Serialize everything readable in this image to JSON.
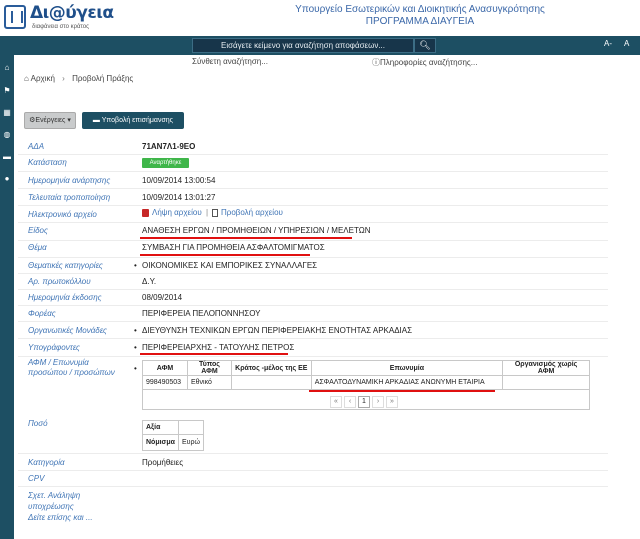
{
  "header": {
    "logo_title": "Δι@ύγεια",
    "logo_subtitle": "διαφάνεια στο κράτος",
    "ministry_line1": "Υπουργείο Εσωτερικών και Διοικητικής Ανασυγκρότησης",
    "ministry_line2": "ΠΡΟΓΡΑΜΜΑ ΔΙΑΥΓΕΙΑ"
  },
  "search": {
    "placeholder": "Εισάγετε κείμενο για αναζήτηση αποφάσεων...",
    "advanced": "Σύνθετη αναζήτηση...",
    "info": "Πληροφορίες αναζήτησης...",
    "font_decrease": "A-",
    "font_increase": "A"
  },
  "breadcrumb": {
    "home": "Αρχική",
    "current": "Προβολή Πράξης"
  },
  "actions": {
    "actions_label": "Ενέργειες",
    "report_label": "Υποβολή επισήμανσης"
  },
  "fields": {
    "ada_label": "ΑΔΑ",
    "ada": "71ΑΝ7Λ1-9ΕΟ",
    "status_label": "Κατάσταση",
    "status": "Αναρτήθηκε",
    "posted_label": "Ημερομηνία ανάρτησης",
    "posted": "10/09/2014 13:00:54",
    "modified_label": "Τελευταία τροποποίηση",
    "modified": "10/09/2014 13:01:27",
    "file_label": "Ηλεκτρονικό αρχείο",
    "download": "Λήψη αρχείου",
    "view": "Προβολή αρχείου",
    "type_label": "Είδος",
    "type": "ΑΝΑΘΕΣΗ ΕΡΓΩΝ / ΠΡΟΜΗΘΕΙΩΝ / ΥΠΗΡΕΣΙΩΝ / ΜΕΛΕΤΩΝ",
    "subject_label": "Θέμα",
    "subject": "ΣΥΜΒΑΣΗ ΓΙΑ ΠΡΟΜΗΘΕΙΑ ΑΣΦΑΛΤΟΜΙΓΜΑΤΟΣ",
    "categories_label": "Θεματικές κατηγορίες",
    "categories": "ΟΙΚΟΝΟΜΙΚΕΣ ΚΑΙ ΕΜΠΟΡΙΚΕΣ ΣΥΝΑΛΛΑΓΕΣ",
    "protocol_label": "Αρ. πρωτοκόλλου",
    "protocol": "Δ.Υ.",
    "issue_date_label": "Ημερομηνία έκδοσης",
    "issue_date": "08/09/2014",
    "body_label": "Φορέας",
    "body": "ΠΕΡΙΦΕΡΕΙΑ ΠΕΛΟΠΟΝΝΗΣΟΥ",
    "units_label": "Οργανωτικές Μονάδες",
    "units": "ΔΙΕΥΘΥΝΣΗ ΤΕΧΝΙΚΩΝ ΕΡΓΩΝ ΠΕΡΙΦΕΡΕΙΑΚΗΣ ΕΝΟΤΗΤΑΣ ΑΡΚΑΔΙΑΣ",
    "signers_label": "Υπογράφοντες",
    "signers": "ΠΕΡΙΦΕΡΕΙΑΡΧΗΣ - ΤΑΤΟΥΛΗΣ ΠΕΤΡΟΣ",
    "afm_label_1": "ΑΦΜ / Επωνυμία",
    "afm_label_2": "προσώπου / προσώπων",
    "amount_label": "Ποσό",
    "category_label": "Κατηγορία",
    "category": "Προμήθειες",
    "cpv_label": "CPV",
    "related_label_1": "Σχετ. Ανάληψη",
    "related_label_2": "υποχρέωσης",
    "see_also_label": "Δείτε επίσης και ..."
  },
  "afm_table": {
    "headers": [
      "ΑΦΜ",
      "Τύπος ΑΦΜ",
      "Κράτος -μέλος της ΕΕ",
      "Επωνυμία",
      "Οργανισμός χωρίς ΑΦΜ"
    ],
    "rows": [
      [
        "998490503",
        "Εθνικό",
        "",
        "ΑΣΦΑΛΤΟΔΥΝΑΜΙΚΗ ΑΡΚΑΔΙΑΣ ΑΝΩΝΥΜΗ ΕΤΑΙΡΙΑ",
        ""
      ]
    ],
    "pager": [
      "«",
      "‹",
      "1",
      "›",
      "»"
    ]
  },
  "amount_table": {
    "value_header": "Αξία",
    "currency_header": "Νόμισμα",
    "currency": "Ευρώ"
  }
}
